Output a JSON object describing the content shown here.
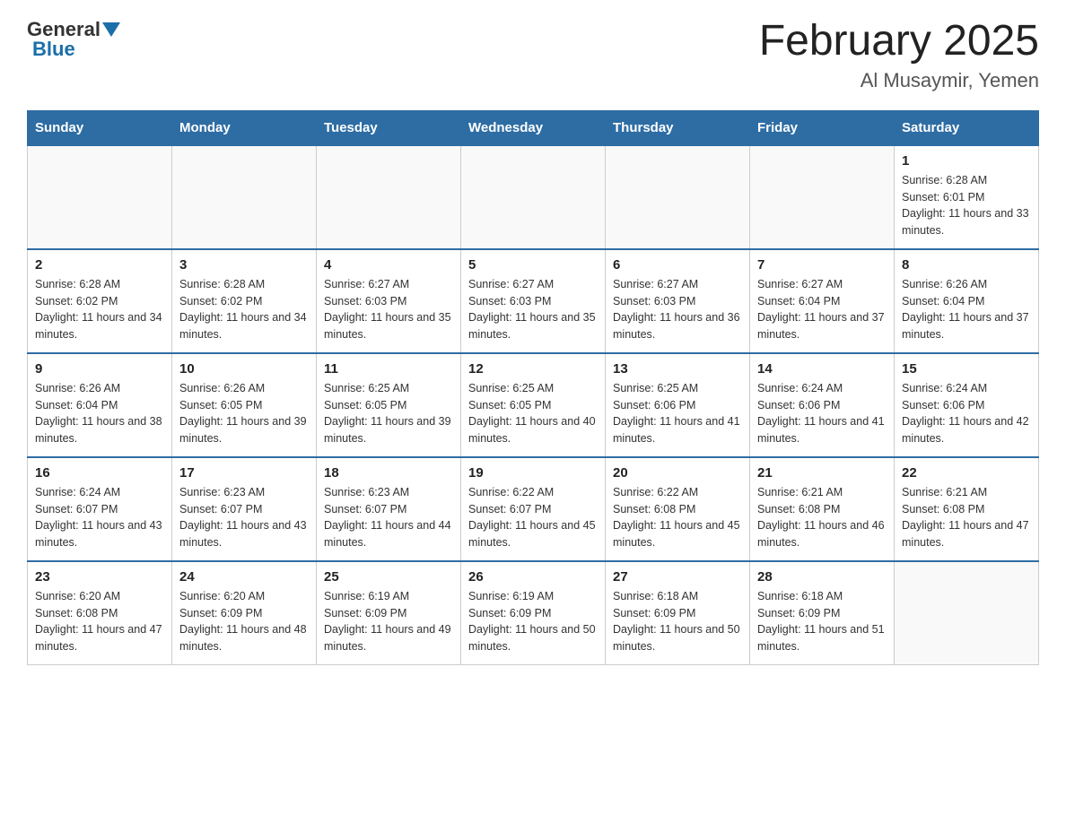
{
  "header": {
    "logo_general": "General",
    "logo_blue": "Blue",
    "title": "February 2025",
    "subtitle": "Al Musaymir, Yemen"
  },
  "days_of_week": [
    "Sunday",
    "Monday",
    "Tuesday",
    "Wednesday",
    "Thursday",
    "Friday",
    "Saturday"
  ],
  "weeks": [
    [
      {
        "day": "",
        "sunrise": "",
        "sunset": "",
        "daylight": ""
      },
      {
        "day": "",
        "sunrise": "",
        "sunset": "",
        "daylight": ""
      },
      {
        "day": "",
        "sunrise": "",
        "sunset": "",
        "daylight": ""
      },
      {
        "day": "",
        "sunrise": "",
        "sunset": "",
        "daylight": ""
      },
      {
        "day": "",
        "sunrise": "",
        "sunset": "",
        "daylight": ""
      },
      {
        "day": "",
        "sunrise": "",
        "sunset": "",
        "daylight": ""
      },
      {
        "day": "1",
        "sunrise": "Sunrise: 6:28 AM",
        "sunset": "Sunset: 6:01 PM",
        "daylight": "Daylight: 11 hours and 33 minutes."
      }
    ],
    [
      {
        "day": "2",
        "sunrise": "Sunrise: 6:28 AM",
        "sunset": "Sunset: 6:02 PM",
        "daylight": "Daylight: 11 hours and 34 minutes."
      },
      {
        "day": "3",
        "sunrise": "Sunrise: 6:28 AM",
        "sunset": "Sunset: 6:02 PM",
        "daylight": "Daylight: 11 hours and 34 minutes."
      },
      {
        "day": "4",
        "sunrise": "Sunrise: 6:27 AM",
        "sunset": "Sunset: 6:03 PM",
        "daylight": "Daylight: 11 hours and 35 minutes."
      },
      {
        "day": "5",
        "sunrise": "Sunrise: 6:27 AM",
        "sunset": "Sunset: 6:03 PM",
        "daylight": "Daylight: 11 hours and 35 minutes."
      },
      {
        "day": "6",
        "sunrise": "Sunrise: 6:27 AM",
        "sunset": "Sunset: 6:03 PM",
        "daylight": "Daylight: 11 hours and 36 minutes."
      },
      {
        "day": "7",
        "sunrise": "Sunrise: 6:27 AM",
        "sunset": "Sunset: 6:04 PM",
        "daylight": "Daylight: 11 hours and 37 minutes."
      },
      {
        "day": "8",
        "sunrise": "Sunrise: 6:26 AM",
        "sunset": "Sunset: 6:04 PM",
        "daylight": "Daylight: 11 hours and 37 minutes."
      }
    ],
    [
      {
        "day": "9",
        "sunrise": "Sunrise: 6:26 AM",
        "sunset": "Sunset: 6:04 PM",
        "daylight": "Daylight: 11 hours and 38 minutes."
      },
      {
        "day": "10",
        "sunrise": "Sunrise: 6:26 AM",
        "sunset": "Sunset: 6:05 PM",
        "daylight": "Daylight: 11 hours and 39 minutes."
      },
      {
        "day": "11",
        "sunrise": "Sunrise: 6:25 AM",
        "sunset": "Sunset: 6:05 PM",
        "daylight": "Daylight: 11 hours and 39 minutes."
      },
      {
        "day": "12",
        "sunrise": "Sunrise: 6:25 AM",
        "sunset": "Sunset: 6:05 PM",
        "daylight": "Daylight: 11 hours and 40 minutes."
      },
      {
        "day": "13",
        "sunrise": "Sunrise: 6:25 AM",
        "sunset": "Sunset: 6:06 PM",
        "daylight": "Daylight: 11 hours and 41 minutes."
      },
      {
        "day": "14",
        "sunrise": "Sunrise: 6:24 AM",
        "sunset": "Sunset: 6:06 PM",
        "daylight": "Daylight: 11 hours and 41 minutes."
      },
      {
        "day": "15",
        "sunrise": "Sunrise: 6:24 AM",
        "sunset": "Sunset: 6:06 PM",
        "daylight": "Daylight: 11 hours and 42 minutes."
      }
    ],
    [
      {
        "day": "16",
        "sunrise": "Sunrise: 6:24 AM",
        "sunset": "Sunset: 6:07 PM",
        "daylight": "Daylight: 11 hours and 43 minutes."
      },
      {
        "day": "17",
        "sunrise": "Sunrise: 6:23 AM",
        "sunset": "Sunset: 6:07 PM",
        "daylight": "Daylight: 11 hours and 43 minutes."
      },
      {
        "day": "18",
        "sunrise": "Sunrise: 6:23 AM",
        "sunset": "Sunset: 6:07 PM",
        "daylight": "Daylight: 11 hours and 44 minutes."
      },
      {
        "day": "19",
        "sunrise": "Sunrise: 6:22 AM",
        "sunset": "Sunset: 6:07 PM",
        "daylight": "Daylight: 11 hours and 45 minutes."
      },
      {
        "day": "20",
        "sunrise": "Sunrise: 6:22 AM",
        "sunset": "Sunset: 6:08 PM",
        "daylight": "Daylight: 11 hours and 45 minutes."
      },
      {
        "day": "21",
        "sunrise": "Sunrise: 6:21 AM",
        "sunset": "Sunset: 6:08 PM",
        "daylight": "Daylight: 11 hours and 46 minutes."
      },
      {
        "day": "22",
        "sunrise": "Sunrise: 6:21 AM",
        "sunset": "Sunset: 6:08 PM",
        "daylight": "Daylight: 11 hours and 47 minutes."
      }
    ],
    [
      {
        "day": "23",
        "sunrise": "Sunrise: 6:20 AM",
        "sunset": "Sunset: 6:08 PM",
        "daylight": "Daylight: 11 hours and 47 minutes."
      },
      {
        "day": "24",
        "sunrise": "Sunrise: 6:20 AM",
        "sunset": "Sunset: 6:09 PM",
        "daylight": "Daylight: 11 hours and 48 minutes."
      },
      {
        "day": "25",
        "sunrise": "Sunrise: 6:19 AM",
        "sunset": "Sunset: 6:09 PM",
        "daylight": "Daylight: 11 hours and 49 minutes."
      },
      {
        "day": "26",
        "sunrise": "Sunrise: 6:19 AM",
        "sunset": "Sunset: 6:09 PM",
        "daylight": "Daylight: 11 hours and 50 minutes."
      },
      {
        "day": "27",
        "sunrise": "Sunrise: 6:18 AM",
        "sunset": "Sunset: 6:09 PM",
        "daylight": "Daylight: 11 hours and 50 minutes."
      },
      {
        "day": "28",
        "sunrise": "Sunrise: 6:18 AM",
        "sunset": "Sunset: 6:09 PM",
        "daylight": "Daylight: 11 hours and 51 minutes."
      },
      {
        "day": "",
        "sunrise": "",
        "sunset": "",
        "daylight": ""
      }
    ]
  ]
}
